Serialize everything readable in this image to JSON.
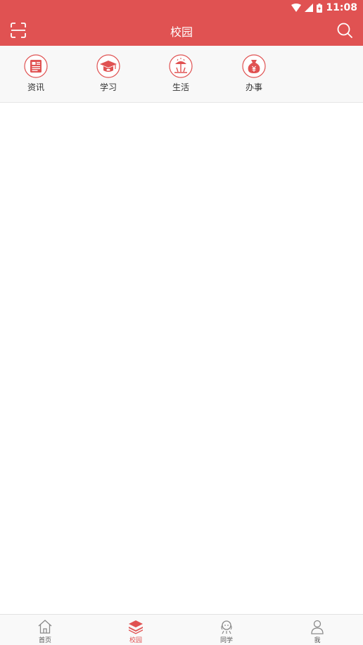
{
  "status_bar": {
    "time": "11:08"
  },
  "header": {
    "title": "校园"
  },
  "categories": [
    {
      "label": "资讯",
      "icon": "newspaper-icon"
    },
    {
      "label": "学习",
      "icon": "graduation-cap-icon"
    },
    {
      "label": "生活",
      "icon": "umbrella-beach-icon"
    },
    {
      "label": "办事",
      "icon": "money-bag-icon"
    }
  ],
  "tabs": [
    {
      "label": "首页",
      "icon": "home-icon",
      "active": false
    },
    {
      "label": "校园",
      "icon": "layers-icon",
      "active": true
    },
    {
      "label": "同学",
      "icon": "classmates-icon",
      "active": false
    },
    {
      "label": "我",
      "icon": "person-icon",
      "active": false
    }
  ],
  "colors": {
    "accent": "#e05252",
    "category_bg": "#f8f8f8",
    "tab_inactive": "#8a8a8a"
  }
}
